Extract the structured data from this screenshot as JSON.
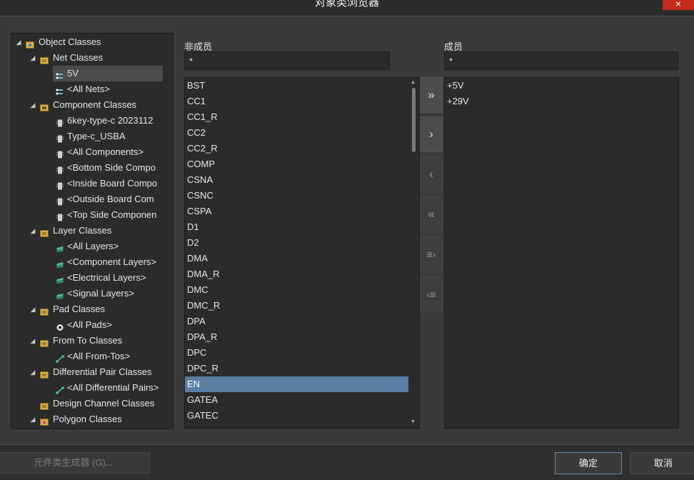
{
  "window": {
    "title": "对象类浏览器",
    "close_icon": "×"
  },
  "tree": {
    "items": [
      {
        "label": "Object Classes",
        "icon": "object-classes-icon"
      },
      {
        "label": "Net Classes",
        "icon": "folder-icon"
      },
      {
        "label": "5V",
        "icon": "net-icon",
        "selected": true
      },
      {
        "label": "<All Nets>",
        "icon": "net-icon"
      },
      {
        "label": "Component Classes",
        "icon": "component-folder-icon"
      },
      {
        "label": "6key-type-c 2023112",
        "icon": "component-icon"
      },
      {
        "label": "Type-c_USBA",
        "icon": "component-icon"
      },
      {
        "label": "<All Components>",
        "icon": "component-icon"
      },
      {
        "label": "<Bottom Side Compo",
        "icon": "component-icon"
      },
      {
        "label": "<Inside Board Compo",
        "icon": "component-icon"
      },
      {
        "label": "<Outside Board Com",
        "icon": "component-icon"
      },
      {
        "label": "<Top Side Componen",
        "icon": "component-icon"
      },
      {
        "label": "Layer Classes",
        "icon": "folder-icon"
      },
      {
        "label": "<All Layers>",
        "icon": "layer-icon"
      },
      {
        "label": "<Component Layers>",
        "icon": "layer-icon"
      },
      {
        "label": "<Electrical Layers>",
        "icon": "layer-icon"
      },
      {
        "label": "<Signal Layers>",
        "icon": "layer-icon"
      },
      {
        "label": "Pad Classes",
        "icon": "folder-icon"
      },
      {
        "label": "<All Pads>",
        "icon": "pad-icon"
      },
      {
        "label": "From To Classes",
        "icon": "folder-icon"
      },
      {
        "label": "<All From-Tos>",
        "icon": "from-to-icon"
      },
      {
        "label": "Differential Pair Classes",
        "icon": "folder-icon"
      },
      {
        "label": "<All Differential Pairs>",
        "icon": "from-to-icon"
      },
      {
        "label": "Design Channel Classes",
        "icon": "folder-icon"
      },
      {
        "label": "Polygon Classes",
        "icon": "polygon-folder-icon"
      }
    ]
  },
  "non_members": {
    "label": "非成员",
    "filter": "*",
    "items": [
      "BST",
      "CC1",
      "CC1_R",
      "CC2",
      "CC2_R",
      "COMP",
      "CSNA",
      "CSNC",
      "CSPA",
      "D1",
      "D2",
      "DMA",
      "DMA_R",
      "DMC",
      "DMC_R",
      "DPA",
      "DPA_R",
      "DPC",
      "DPC_R",
      "EN",
      "GATEA",
      "GATEC"
    ],
    "selected": "EN"
  },
  "members": {
    "label": "成员",
    "filter": "*",
    "items": [
      "+5V",
      "+29V"
    ]
  },
  "move_buttons": {
    "add_all": "»",
    "add": "›",
    "remove": "‹",
    "remove_all": "«",
    "add_selected": "≡›",
    "remove_selected": "‹≡"
  },
  "footer": {
    "generator_label": "元件类生成器 (G)...",
    "ok_label": "确定",
    "cancel_label": "取消"
  },
  "colors": {
    "selection": "#5a7fa3",
    "accent_border": "#6b89ad",
    "close": "#c42b1c"
  }
}
